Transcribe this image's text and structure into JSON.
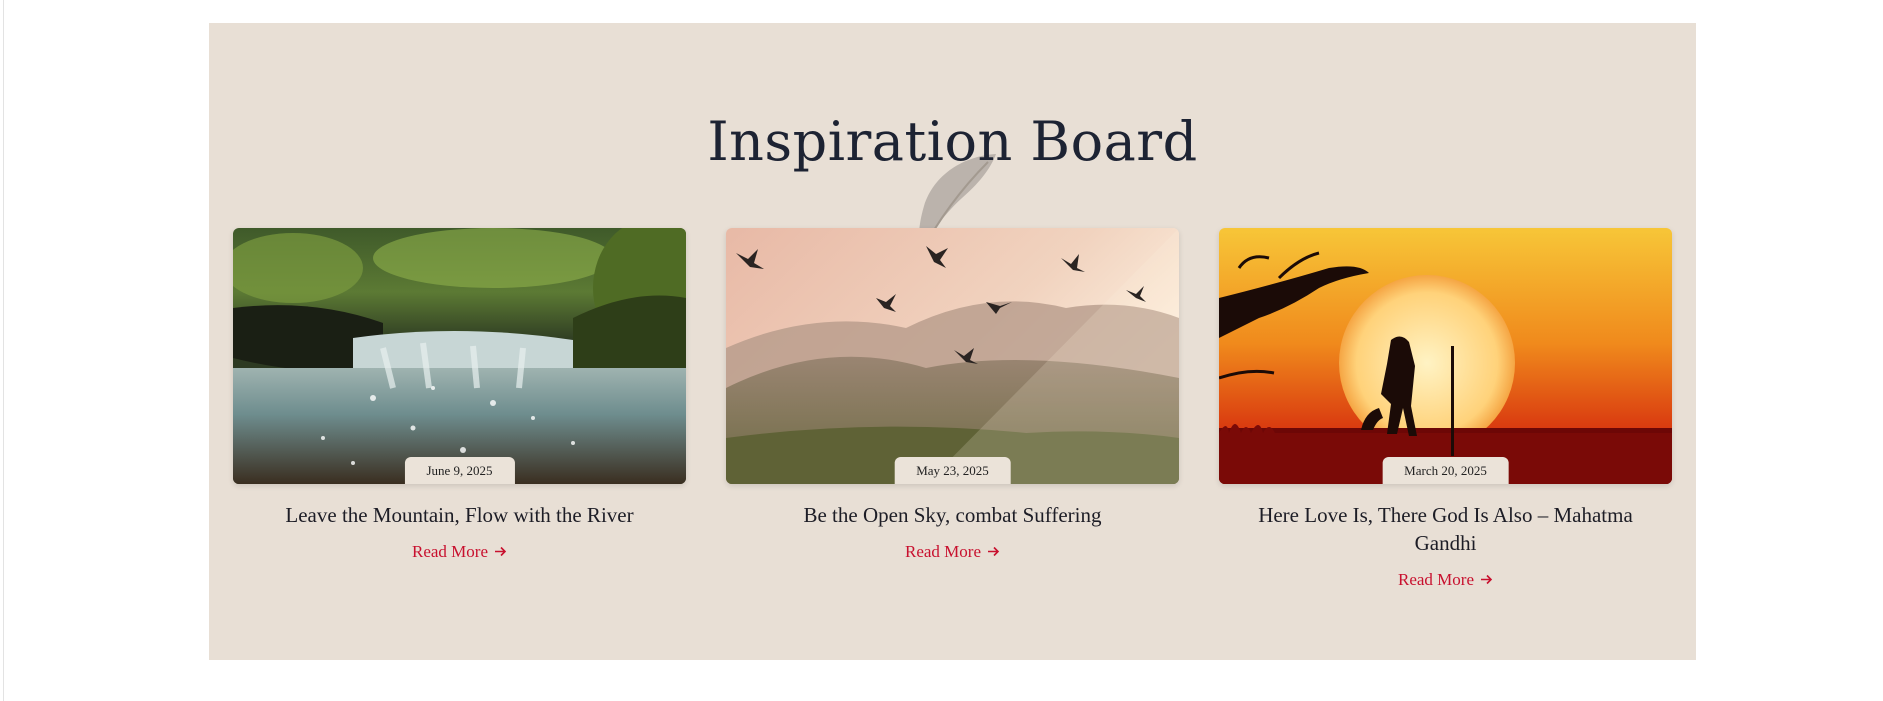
{
  "section": {
    "title": "Inspiration Board",
    "background": "#e8dfd5"
  },
  "posts": [
    {
      "date": "June 9, 2025",
      "title": "Leave the Mountain, Flow with the River",
      "read_more": "Read More",
      "image": "forest-stream-waterfall"
    },
    {
      "date": "May 23, 2025",
      "title": "Be the Open Sky, combat Suffering",
      "read_more": "Read More",
      "image": "birds-over-sunlit-mountains"
    },
    {
      "date": "March 20, 2025",
      "title": "Here Love Is, There God Is Also – Mahatma Gandhi",
      "read_more": "Read More",
      "image": "silhouette-walking-at-sunset"
    }
  ],
  "colors": {
    "accent": "#c8102e",
    "title": "#1d2333"
  },
  "icons": {
    "decoration": "feather-icon",
    "link_arrow": "arrow-right-icon"
  }
}
